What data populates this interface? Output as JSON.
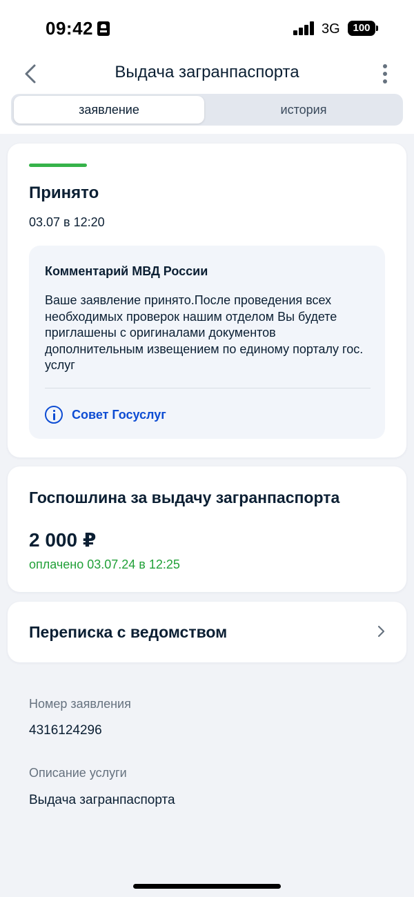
{
  "status_bar": {
    "time": "09:42",
    "network": "3G",
    "battery": "100"
  },
  "header": {
    "title": "Выдача загранпаспорта",
    "back_icon": "chevron-left-icon",
    "menu_icon": "more-vertical-icon"
  },
  "tabs": [
    {
      "label": "заявление",
      "active": true
    },
    {
      "label": "история",
      "active": false
    }
  ],
  "status_card": {
    "status": "Принято",
    "date": "03.07 в 12:20",
    "comment_title": "Комментарий МВД России",
    "comment_text": "Ваше заявление принято.После проведения всех необходимых проверок нашим отделом Вы будете приглашены с оригиналами документов дополнительным извещением по единому порталу гос. услуг",
    "tip_label": "Совет Госуслуг",
    "tip_icon": "info-icon"
  },
  "fee_card": {
    "title": "Госпошлина за выдачу загранпаспорта",
    "amount": "2 000 ₽",
    "paid_text": "оплачено 03.07.24 в 12:25"
  },
  "correspondence": {
    "title": "Переписка с ведомством"
  },
  "details": {
    "application_number_label": "Номер заявления",
    "application_number": "4316124296",
    "service_description_label": "Описание услуги",
    "service_description": "Выдача загранпаспорта"
  },
  "colors": {
    "accent_blue": "#0d4cd3",
    "success_green": "#21a038",
    "progress_green": "#36b34a",
    "text_primary": "#0b1f33",
    "text_secondary": "#66727f"
  }
}
